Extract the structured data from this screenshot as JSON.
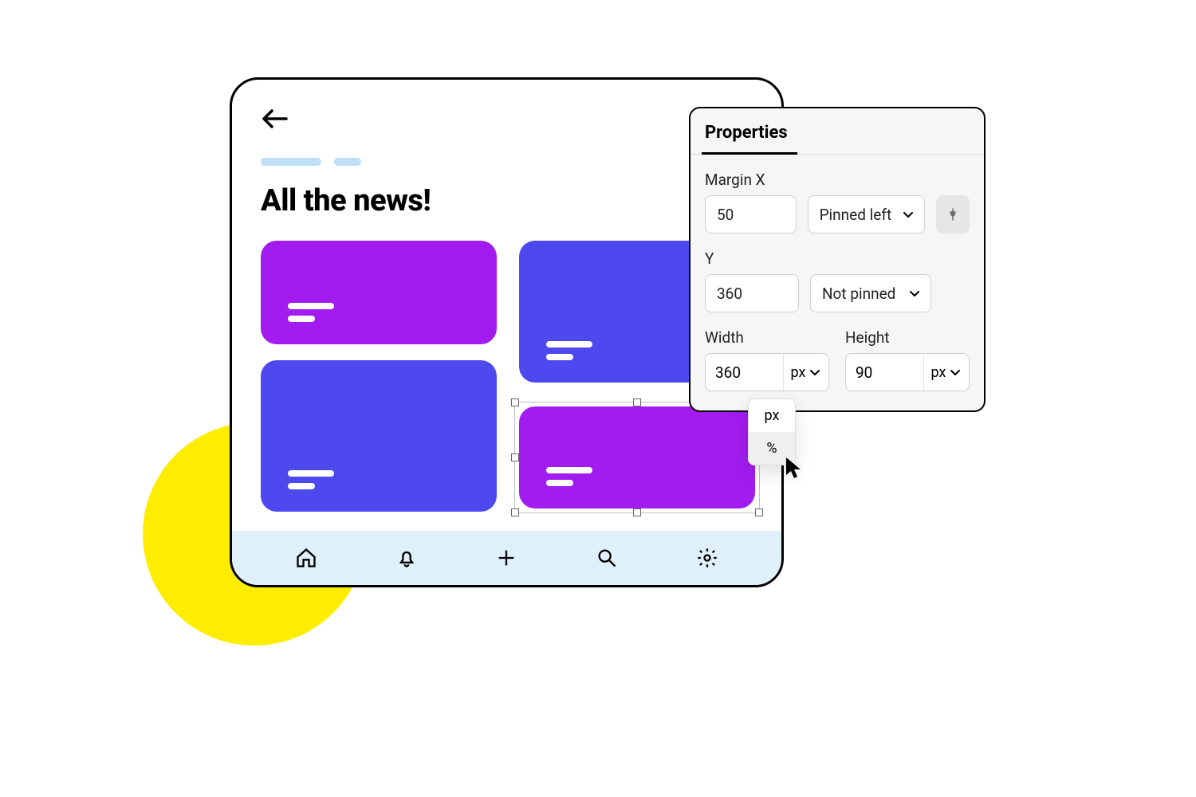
{
  "app": {
    "title": "All the news!"
  },
  "cards": [
    {
      "color": "purple"
    },
    {
      "color": "blue"
    },
    {
      "color": "blue"
    },
    {
      "color": "purple",
      "selected": true
    }
  ],
  "nav": {
    "items": [
      "home",
      "notifications",
      "add",
      "search",
      "settings"
    ]
  },
  "properties": {
    "title": "Properties",
    "margin_x": {
      "label": "Margin X",
      "value": "50",
      "pin_mode": "Pinned left"
    },
    "y": {
      "label": "Y",
      "value": "360",
      "pin_mode": "Not pinned"
    },
    "width": {
      "label": "Width",
      "value": "360",
      "unit": "px"
    },
    "height": {
      "label": "Height",
      "value": "90",
      "unit": "px"
    },
    "unit_options": [
      "px",
      "%"
    ],
    "unit_dropdown_open_for": "width",
    "unit_dropdown_hover": "%"
  }
}
